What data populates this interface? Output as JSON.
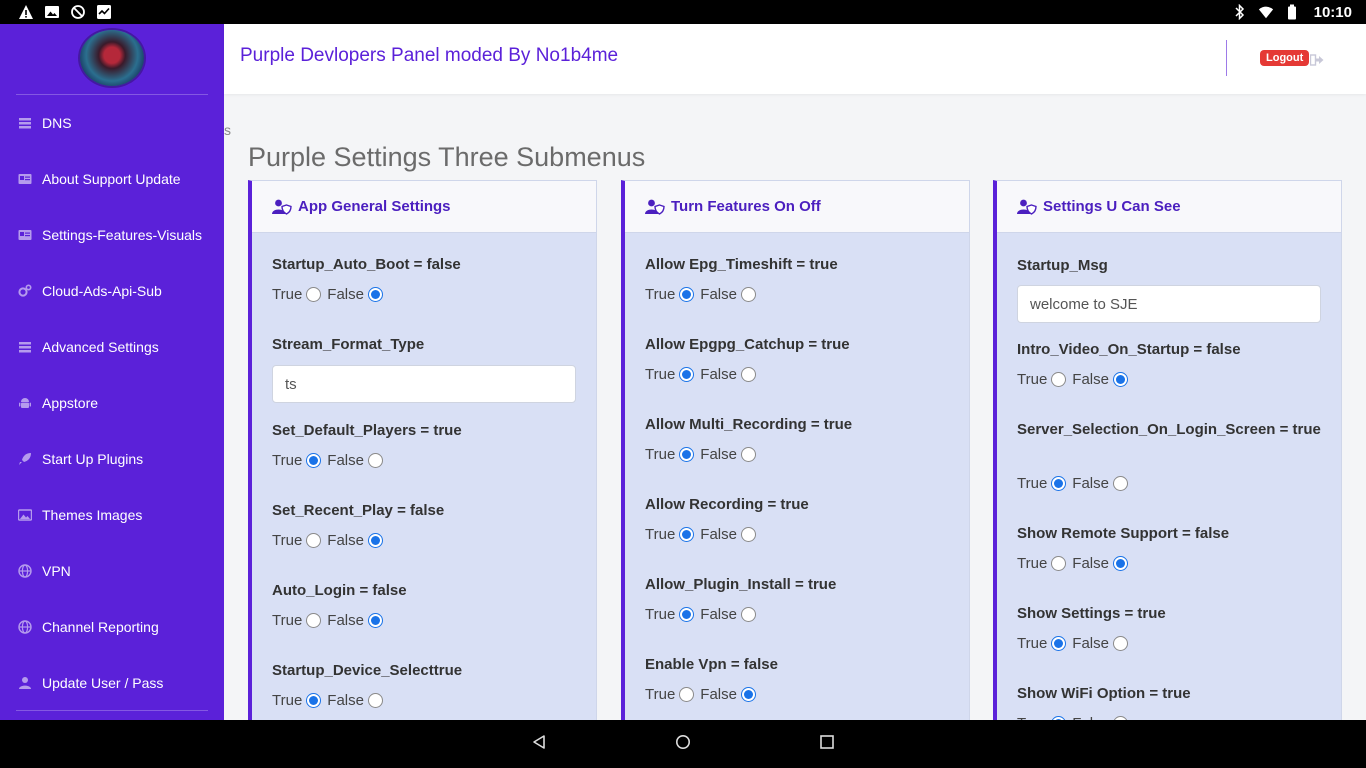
{
  "status_bar": {
    "time": "10:10",
    "left_icons": [
      "warning-icon",
      "image-icon",
      "do-not-disturb-icon",
      "activity-icon"
    ],
    "right_icons": [
      "bluetooth-icon",
      "wifi-icon",
      "battery-icon"
    ]
  },
  "sidebar": {
    "items": [
      {
        "label": "DNS",
        "icon": "list-icon"
      },
      {
        "label": "About Support Update",
        "icon": "id-card-icon"
      },
      {
        "label": "Settings-Features-Visuals",
        "icon": "id-card-icon"
      },
      {
        "label": "Cloud-Ads-Api-Sub",
        "icon": "cogs-icon"
      },
      {
        "label": "Advanced Settings",
        "icon": "list-icon"
      },
      {
        "label": "Appstore",
        "icon": "android-icon"
      },
      {
        "label": "Start Up Plugins",
        "icon": "rocket-icon"
      },
      {
        "label": "Themes Images",
        "icon": "image-icon"
      },
      {
        "label": "VPN",
        "icon": "globe-icon"
      },
      {
        "label": "Channel Reporting",
        "icon": "globe-icon"
      },
      {
        "label": "Update User / Pass",
        "icon": "user-icon"
      }
    ]
  },
  "header": {
    "brand": "Purple Devlopers Panel moded By No1b4me",
    "logout_label": "Logout"
  },
  "breadcrumb": "s",
  "page_title": "Purple Settings Three Submenus",
  "colors": {
    "accent": "#5b21d9",
    "card_bg": "#d9e0f5",
    "radio": "#1a73e8",
    "logout": "#e53935"
  },
  "cards": [
    {
      "title": "App General Settings",
      "fields": [
        {
          "label": "Startup_Auto_Boot = false",
          "type": "radio",
          "value": "false"
        },
        {
          "label": "Stream_Format_Type",
          "type": "text",
          "value": "ts"
        },
        {
          "label": "Set_Default_Players = true",
          "type": "radio",
          "value": "true"
        },
        {
          "label": "Set_Recent_Play = false",
          "type": "radio",
          "value": "false"
        },
        {
          "label": "Auto_Login = false",
          "type": "radio",
          "value": "false"
        },
        {
          "label": "Startup_Device_Selecttrue",
          "type": "radio",
          "value": "true"
        }
      ]
    },
    {
      "title": "Turn Features On Off",
      "fields": [
        {
          "label": "Allow Epg_Timeshift = true",
          "type": "radio",
          "value": "true"
        },
        {
          "label": "Allow Epgpg_Catchup = true",
          "type": "radio",
          "value": "true"
        },
        {
          "label": "Allow Multi_Recording = true",
          "type": "radio",
          "value": "true"
        },
        {
          "label": "Allow Recording = true",
          "type": "radio",
          "value": "true"
        },
        {
          "label": "Allow_Plugin_Install = true",
          "type": "radio",
          "value": "true"
        },
        {
          "label": "Enable Vpn = false",
          "type": "radio",
          "value": "false"
        }
      ]
    },
    {
      "title": "Settings U Can See",
      "fields": [
        {
          "label": "Startup_Msg",
          "type": "text",
          "value": "welcome to SJE"
        },
        {
          "label": "Intro_Video_On_Startup = false",
          "type": "radio",
          "value": "false"
        },
        {
          "label": "Server_Selection_On_Login_Screen = true",
          "type": "radio",
          "value": "true"
        },
        {
          "label": "Show Remote Support = false",
          "type": "radio",
          "value": "false"
        },
        {
          "label": "Show Settings = true",
          "type": "radio",
          "value": "true"
        },
        {
          "label": "Show WiFi Option = true",
          "type": "radio",
          "value": "true"
        }
      ]
    }
  ],
  "radio_labels": {
    "true": "True",
    "false": "False"
  }
}
